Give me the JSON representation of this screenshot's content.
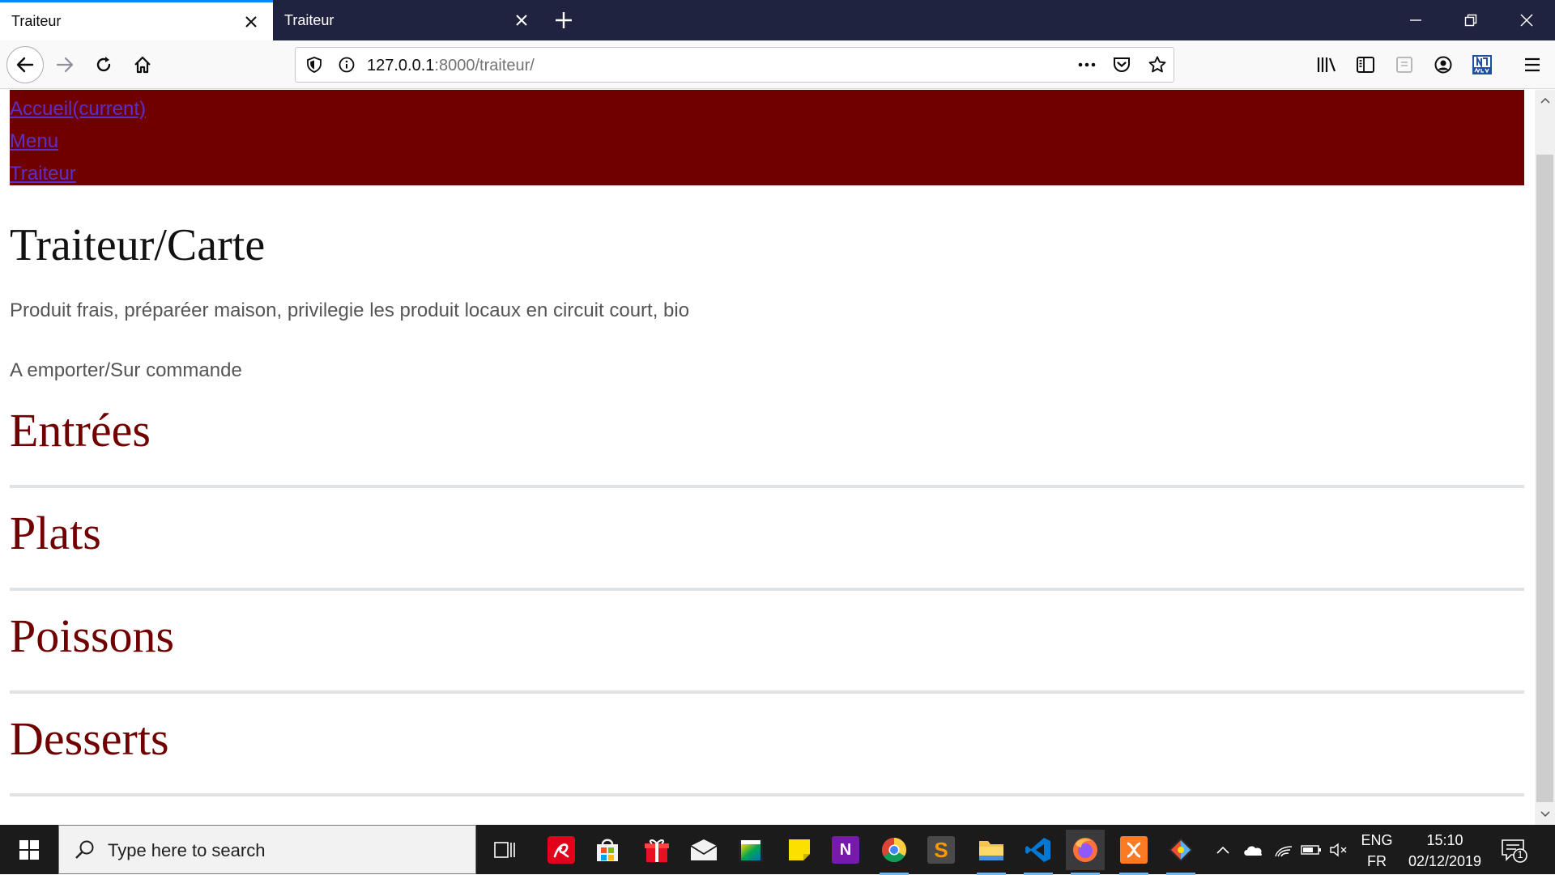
{
  "browser": {
    "tabs": [
      {
        "title": "Traiteur",
        "active": true
      },
      {
        "title": "Traiteur",
        "active": false
      }
    ],
    "url": {
      "host": "127.0.0.1",
      "rest": ":8000/traiteur/"
    }
  },
  "page": {
    "nav_links": [
      "Accueil(current)",
      "Menu",
      "Traiteur"
    ],
    "title": "Traiteur/Carte",
    "intro": "Produit frais, préparéer maison, privilegie les produit locaux en circuit court, bio",
    "service": "A emporter/Sur commande",
    "sections": [
      "Entrées",
      "Plats",
      "Poissons",
      "Desserts"
    ],
    "colors": {
      "nav_bg": "#700000",
      "heading": "#700000",
      "link": "#5a30c8"
    }
  },
  "taskbar": {
    "search_placeholder": "Type here to search",
    "apps": [
      "task-view",
      "avira",
      "store",
      "gift",
      "mail",
      "studio",
      "sticky-notes",
      "onenote",
      "chrome",
      "sublime-text",
      "file-explorer",
      "vscode",
      "firefox",
      "xampp",
      "git-kraken"
    ],
    "lang_top": "ENG",
    "lang_bottom": "FR",
    "time": "15:10",
    "date": "02/12/2019",
    "notifications": "1"
  }
}
